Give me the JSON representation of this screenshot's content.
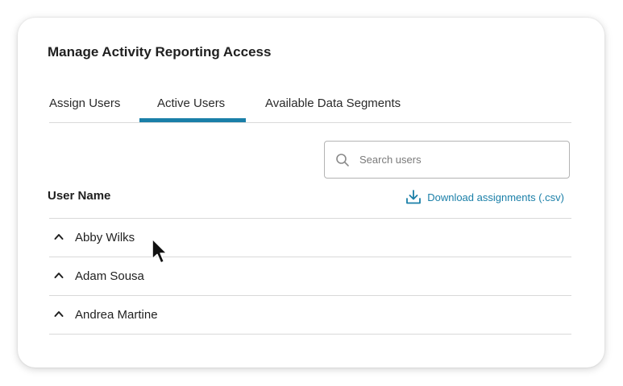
{
  "panel": {
    "title": "Manage Activity Reporting Access"
  },
  "tabs": [
    {
      "label": "Assign Users",
      "active": false
    },
    {
      "label": "Active Users",
      "active": true
    },
    {
      "label": "Available Data Segments",
      "active": false
    }
  ],
  "search": {
    "placeholder": "Search users",
    "value": ""
  },
  "list": {
    "column_header": "User Name",
    "download_label": "Download assignments (.csv)",
    "users": [
      {
        "name": "Abby Wilks",
        "expanded": false
      },
      {
        "name": "Adam Sousa",
        "expanded": false
      },
      {
        "name": "Andrea Martine",
        "expanded": false
      }
    ]
  },
  "colors": {
    "accent": "#1a7fa8",
    "divider": "#d9d9d9",
    "text": "#1f1f1f"
  },
  "icons": {
    "search": "search-icon",
    "download": "download-icon",
    "row_toggle": "chevron-up-icon",
    "pointer": "mouse-pointer-icon"
  }
}
